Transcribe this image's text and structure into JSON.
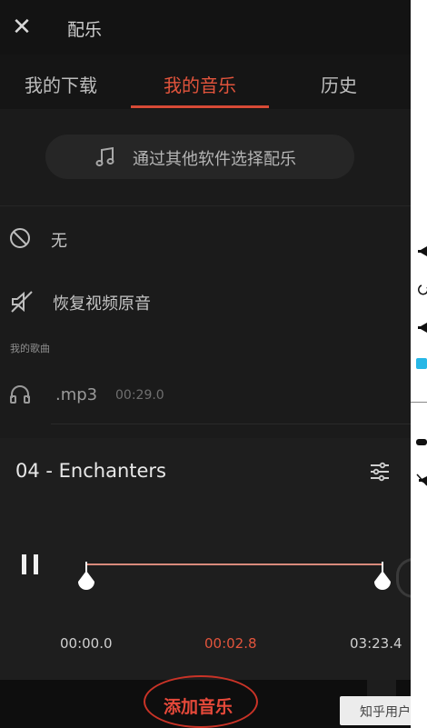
{
  "header": {
    "title": "配乐",
    "close_icon": "close-icon"
  },
  "tabs": [
    {
      "label": "我的下载",
      "active": false
    },
    {
      "label": "我的音乐",
      "active": true
    },
    {
      "label": "历史",
      "active": false
    }
  ],
  "picker": {
    "label": "通过其他软件选择配乐",
    "icon": "music-note-icon"
  },
  "options": {
    "none_label": "无",
    "restore_label": "恢复视频原音"
  },
  "my_songs": {
    "section_label": "我的歌曲",
    "items": [
      {
        "name": ".mp3",
        "duration": "00:29.0"
      }
    ]
  },
  "player": {
    "track_title": "04 - Enchanters",
    "start_time": "00:00.0",
    "current_time": "00:02.8",
    "end_time": "03:23.4"
  },
  "add_button": {
    "label": "添加音乐"
  },
  "watermark": {
    "text": "知乎用户"
  },
  "colors": {
    "accent": "#e2543c",
    "background": "#101010",
    "panel": "#1e1e1e"
  }
}
